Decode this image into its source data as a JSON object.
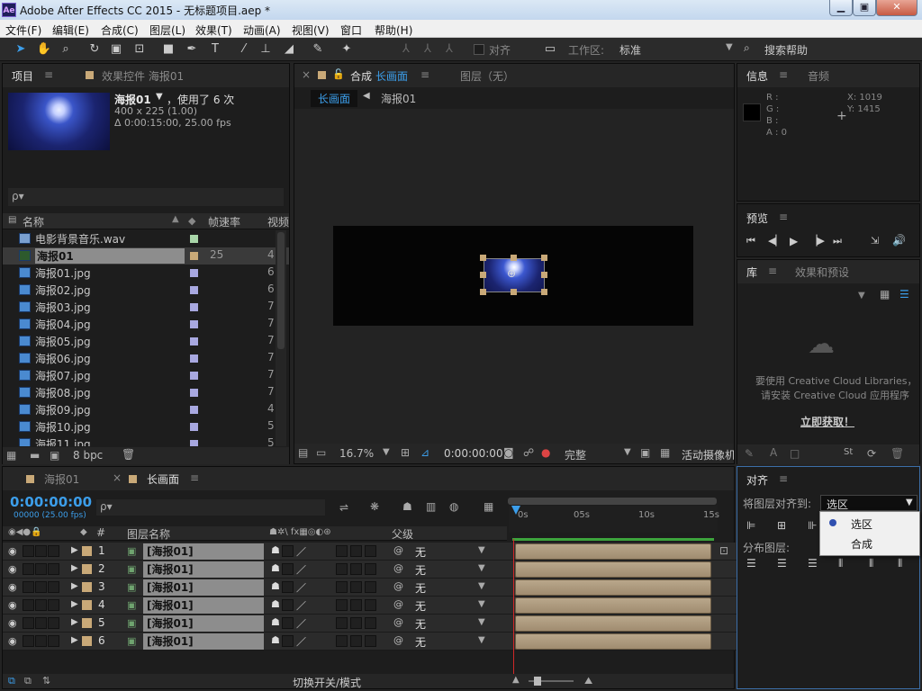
{
  "window": {
    "logo": "Ae",
    "title": "Adobe After Effects CC 2015 - 无标题项目.aep *",
    "min": "▁",
    "max": "▣",
    "close": "✕"
  },
  "menu": [
    "文件(F)",
    "编辑(E)",
    "合成(C)",
    "图层(L)",
    "效果(T)",
    "动画(A)",
    "视图(V)",
    "窗口",
    "帮助(H)"
  ],
  "toolbar": {
    "align_label": "对齐",
    "workspace_label": "工作区:",
    "workspace_value": "标准",
    "search_help": "搜索帮助"
  },
  "project": {
    "tab": "项目",
    "effects_tab": "效果控件 海报01",
    "item_name": "海报01",
    "item_usage": "，使用了 6 次",
    "item_size": "400 x 225 (1.00)",
    "item_time": "Δ 0:00:15:00, 25.00 fps",
    "search_placeholder": "ρ▾",
    "col_name": "名称",
    "col_fps": "帧速率",
    "col_video": "视频",
    "bpc": "8 bpc",
    "files": [
      {
        "name": "电影背景音乐.wav",
        "fps": "",
        "v": "",
        "sel": false,
        "type": "audio",
        "color": "#a9d6a9"
      },
      {
        "name": "海报01",
        "fps": "25",
        "v": "4",
        "sel": true,
        "type": "comp",
        "color": "#c9a978"
      },
      {
        "name": "海报01.jpg",
        "fps": "",
        "v": "6",
        "sel": false,
        "type": "img",
        "color": "#a8a8e0"
      },
      {
        "name": "海报02.jpg",
        "fps": "",
        "v": "6",
        "sel": false,
        "type": "img",
        "color": "#a8a8e0"
      },
      {
        "name": "海报03.jpg",
        "fps": "",
        "v": "7",
        "sel": false,
        "type": "img",
        "color": "#a8a8e0"
      },
      {
        "name": "海报04.jpg",
        "fps": "",
        "v": "7",
        "sel": false,
        "type": "img",
        "color": "#a8a8e0"
      },
      {
        "name": "海报05.jpg",
        "fps": "",
        "v": "7",
        "sel": false,
        "type": "img",
        "color": "#a8a8e0"
      },
      {
        "name": "海报06.jpg",
        "fps": "",
        "v": "7",
        "sel": false,
        "type": "img",
        "color": "#a8a8e0"
      },
      {
        "name": "海报07.jpg",
        "fps": "",
        "v": "7",
        "sel": false,
        "type": "img",
        "color": "#a8a8e0"
      },
      {
        "name": "海报08.jpg",
        "fps": "",
        "v": "7",
        "sel": false,
        "type": "img",
        "color": "#a8a8e0"
      },
      {
        "name": "海报09.jpg",
        "fps": "",
        "v": "4",
        "sel": false,
        "type": "img",
        "color": "#a8a8e0"
      },
      {
        "name": "海报10.jpg",
        "fps": "",
        "v": "5",
        "sel": false,
        "type": "img",
        "color": "#a8a8e0"
      },
      {
        "name": "海报11.jpg",
        "fps": "",
        "v": "5",
        "sel": false,
        "type": "img",
        "color": "#a8a8e0"
      }
    ]
  },
  "comp": {
    "close": "×",
    "lock": "🔓",
    "label": "合成",
    "name": "长画面",
    "layer_label": "图层（无）",
    "breadcrumb_a": "长画面",
    "breadcrumb_b": "海报01",
    "zoom": "16.7%",
    "time": "0:00:00:00",
    "quality": "完整",
    "camera": "活动摄像机"
  },
  "info": {
    "tab": "信息",
    "audio_tab": "音频",
    "r": "R :",
    "g": "G :",
    "b": "B :",
    "a": "A : 0",
    "x": "X: 1019",
    "y": "Y: 1415"
  },
  "preview": {
    "tab": "预览"
  },
  "library": {
    "tab": "库",
    "effects_tab": "效果和预设",
    "msg1": "要使用 Creative Cloud Libraries，",
    "msg2": "请安装 Creative Cloud 应用程序",
    "link": "立即获取！"
  },
  "timeline": {
    "tab1": "海报01",
    "tab2": "长画面",
    "time": "0:00:00:00",
    "fps": "00000 (25.00 fps)",
    "col_num": "#",
    "col_name": "图层名称",
    "col_parent": "父级",
    "ticks": [
      "0s",
      "05s",
      "10s",
      "15s"
    ],
    "toggle": "切换开关/模式",
    "layers": [
      {
        "num": "1",
        "name": "[海报01]",
        "parent": "无"
      },
      {
        "num": "2",
        "name": "[海报01]",
        "parent": "无"
      },
      {
        "num": "3",
        "name": "[海报01]",
        "parent": "无"
      },
      {
        "num": "4",
        "name": "[海报01]",
        "parent": "无"
      },
      {
        "num": "5",
        "name": "[海报01]",
        "parent": "无"
      },
      {
        "num": "6",
        "name": "[海报01]",
        "parent": "无"
      }
    ]
  },
  "align": {
    "tab": "对齐",
    "align_to_label": "将图层对齐到:",
    "align_to_value": "选区",
    "distribute_label": "分布图层:",
    "options": [
      {
        "label": "选区",
        "selected": true
      },
      {
        "label": "合成",
        "selected": false
      }
    ]
  }
}
